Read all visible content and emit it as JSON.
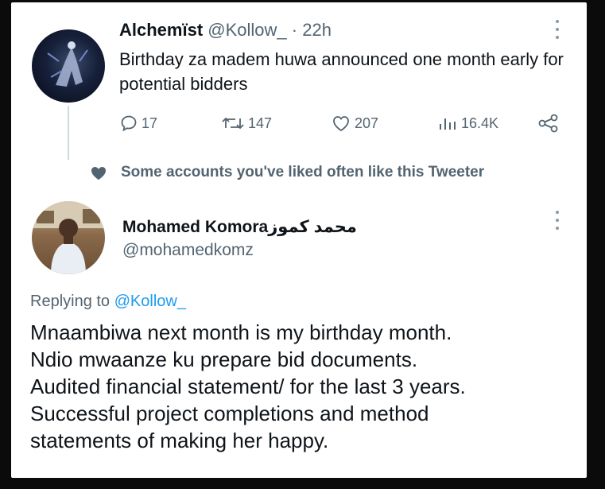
{
  "tweet1": {
    "author_name": "Alchemïst",
    "handle": "@Kollow_",
    "separator": " · ",
    "time": "22h",
    "text": "Birthday za madem huwa announced one month early for potential bidders",
    "stats": {
      "replies": "17",
      "retweets": "147",
      "likes": "207",
      "views": "16.4K"
    },
    "icons": {
      "reply": "reply-icon",
      "retweet": "retweet-icon",
      "like": "heart-icon",
      "views": "views-icon",
      "share": "share-icon",
      "more": "more-options-icon"
    }
  },
  "liked_notice": {
    "text": "Some accounts you've liked often like this Tweeter",
    "icon": "heart-icon"
  },
  "tweet2": {
    "author_name": "Mohamed Komoraمحمد كموز",
    "handle": "@mohamedkomz",
    "replying_prefix": "Replying to ",
    "replying_to": "@Kollow_",
    "lines": [
      "Mnaambiwa next month is my birthday month.",
      "Ndio mwaanze ku prepare bid documents.",
      "Audited financial statement/ for the last 3 years.",
      "Successful project completions and method",
      "statements of making her happy."
    ]
  },
  "colors": {
    "background": "#0b0b0b",
    "card": "#ffffff",
    "text": "#0f1419",
    "secondary": "#536471",
    "accent": "#1d9bf0"
  }
}
